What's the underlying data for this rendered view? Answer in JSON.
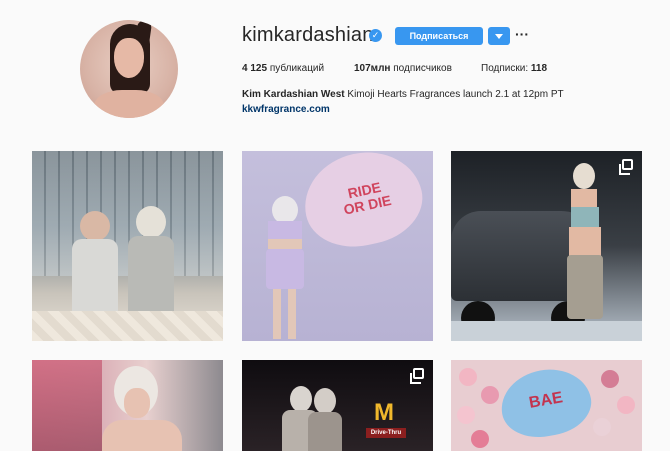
{
  "profile": {
    "username": "kimkardashian",
    "verified_mark": "✓",
    "follow_label": "Подписаться",
    "more_label": "···",
    "stats": {
      "posts_value": "4 125",
      "posts_label": "публикаций",
      "followers_value": "107млн",
      "followers_label": "подписчиков",
      "following_label": "Подписки:",
      "following_value": "118"
    },
    "bio": {
      "name": "Kim Kardashian West",
      "text": "Kimoji Hearts Fragrances launch 2.1 at 12pm PT",
      "link": "kkwfragrance.com"
    }
  },
  "posts": [
    {
      "id": "post-1",
      "multi": false
    },
    {
      "id": "post-2",
      "multi": false,
      "sticker": "RIDE\nOR DIE"
    },
    {
      "id": "post-3",
      "multi": true
    },
    {
      "id": "post-4",
      "multi": false
    },
    {
      "id": "post-5",
      "multi": true,
      "sign": "Drive-Thru"
    },
    {
      "id": "post-6",
      "multi": false,
      "sticker": "BAE"
    }
  ],
  "colors": {
    "accent": "#3897f0",
    "background": "#fafafa",
    "link": "#003569"
  },
  "icons": [
    "verified-badge-icon",
    "chevron-down-icon",
    "more-options-icon",
    "multiple-photos-icon"
  ]
}
